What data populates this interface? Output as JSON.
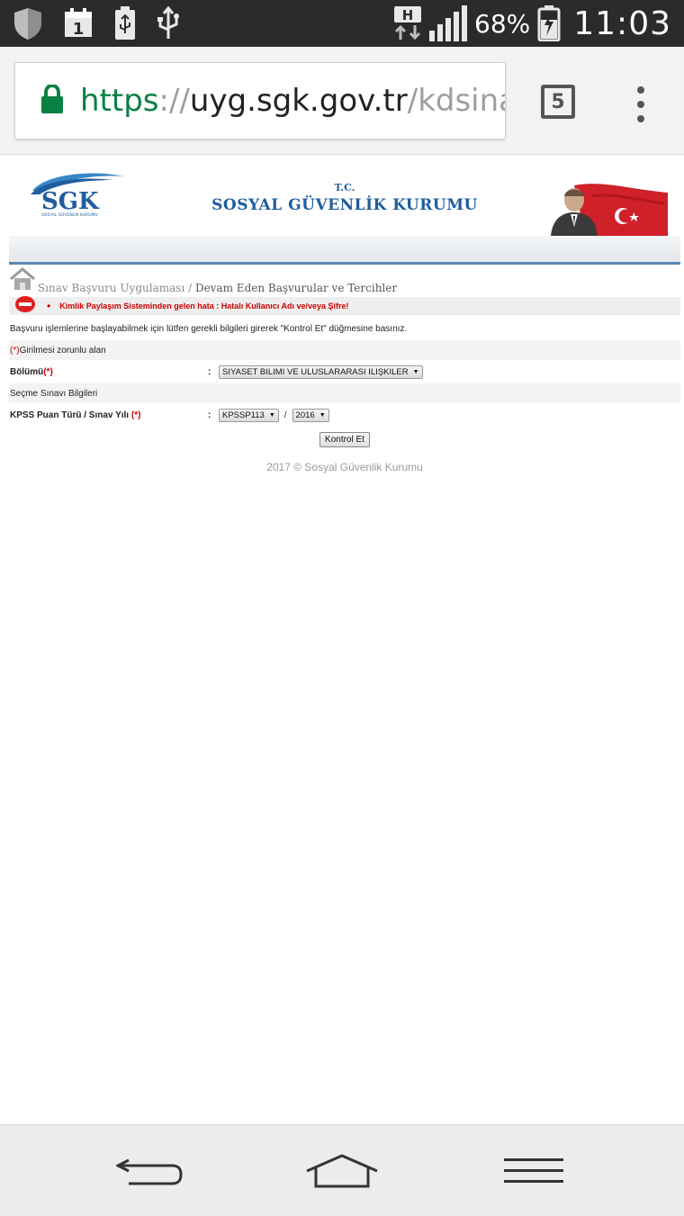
{
  "status_bar": {
    "battery_percent": "68%",
    "network_type": "H",
    "time": "11:03",
    "icons": [
      "shield-icon",
      "calendar-icon",
      "battery-usb-icon",
      "usb-icon",
      "signal-icon",
      "battery-icon"
    ]
  },
  "browser": {
    "url_scheme": "https",
    "url_sep": "://",
    "url_host": "uyg.sgk.gov.tr",
    "url_path": "/kdsinav",
    "tab_count": "5"
  },
  "header": {
    "logo_text": "SGK",
    "logo_subtext": "SOSYAL GÜVENLİK KURUMU",
    "tc": "T.C.",
    "org_name": "SOSYAL GÜVENLİK KURUMU"
  },
  "breadcrumb": {
    "app": "Sınav Başvuru Uygulaması",
    "separator": " / ",
    "page": "Devam Eden Başvurular ve Tercihler"
  },
  "error": {
    "bullet": "•",
    "message": "Kimlik Paylaşım Sisteminden gelen hata : Hatalı Kullanıcı Adı ve/veya Şifre!"
  },
  "form": {
    "intro": "Başvuru işlemlerine başlayabilmek için lütfen gerekli bilgileri girerek \"Kontrol Et\" düğmesine basınız.",
    "required_marker": "(*)",
    "required_note": "Girilmesi zorunlu alan",
    "department_label": "Bölümü",
    "department_value": "SIYASET BILIMI VE ULUSLARARASI ILIŞKILER",
    "colon": ":",
    "section_title": "Seçme Sınavı Bilgileri",
    "kpss_label": "KPSS Puan Türü / Sınav Yılı ",
    "kpss_type_value": "KPSSP113",
    "slash": "/",
    "exam_year_value": "2016",
    "caret": "▼",
    "submit_label": "Kontrol Et"
  },
  "footer": {
    "text": "2017 © Sosyal Güvenlik Kurumu"
  },
  "colors": {
    "url_green": "#0b8043",
    "brand_blue": "#1f5d9e",
    "error_red": "#cc0000"
  }
}
